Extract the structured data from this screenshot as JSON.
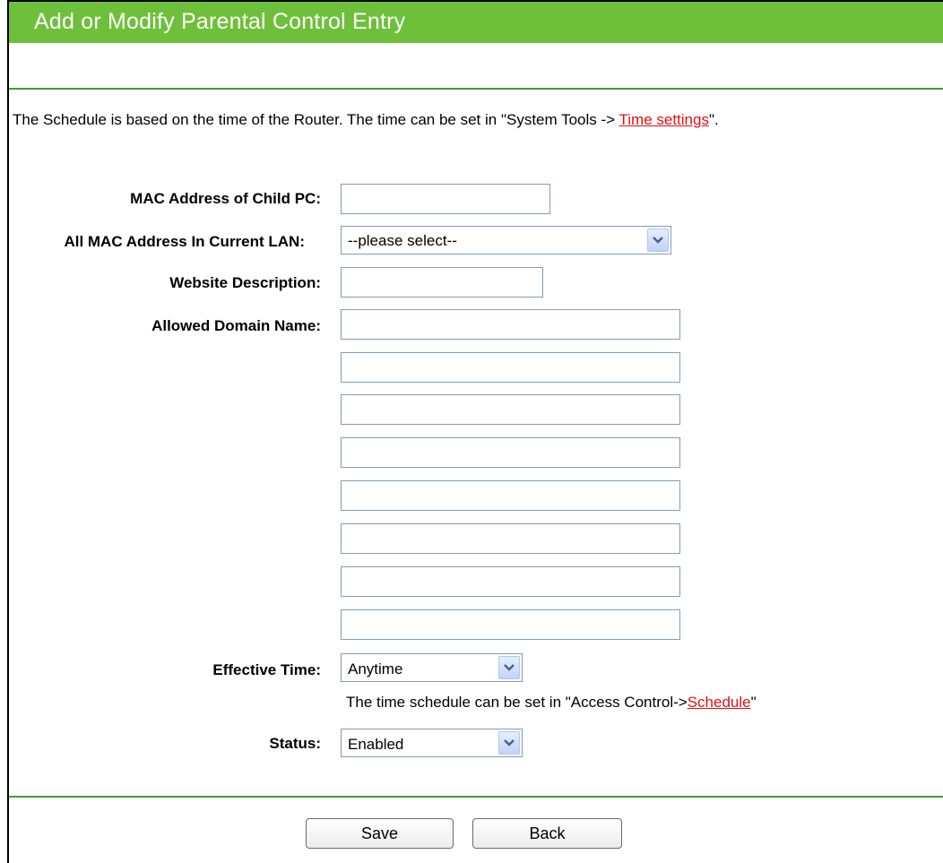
{
  "header": {
    "title": "Add or Modify Parental Control Entry"
  },
  "notice": {
    "prefix": "The Schedule is based on the time of the Router. The time can be set in \"System Tools -> ",
    "link": "Time settings",
    "suffix": "\"."
  },
  "form": {
    "mac_label": "MAC Address of Child PC:",
    "mac_value": "",
    "all_mac_label": "All MAC Address In Current LAN:",
    "all_mac_selected": "--please select--",
    "website_desc_label": "Website Description:",
    "website_desc_value": "",
    "allowed_domain_label": "Allowed Domain Name:",
    "allowed_domains": [
      "",
      "",
      "",
      "",
      "",
      "",
      "",
      ""
    ],
    "effective_time_label": "Effective Time:",
    "effective_time_selected": "Anytime",
    "schedule_hint_prefix": "The time schedule can be set in \"Access Control->",
    "schedule_hint_link": "Schedule",
    "schedule_hint_suffix": "\"",
    "status_label": "Status:",
    "status_selected": "Enabled"
  },
  "buttons": {
    "save": "Save",
    "back": "Back"
  },
  "colors": {
    "header_green": "#6ec03a",
    "rule_green": "#3f9a3f",
    "link_red": "#e01010"
  },
  "icons": {
    "dropdown": "chevron-down-icon"
  }
}
